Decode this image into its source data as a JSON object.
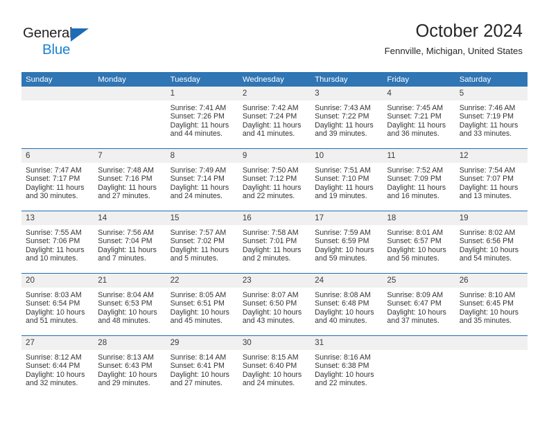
{
  "logo": {
    "line1": "General",
    "line2": "Blue",
    "triangle_color": "#1d6cb5",
    "line2_color": "#1b82d2"
  },
  "header": {
    "title": "October 2024",
    "subtitle": "Fennville, Michigan, United States"
  },
  "colors": {
    "header_row": "#3075b4",
    "day_band": "#f0f0f0",
    "row_divider": "#1d6cb5",
    "text": "#333333"
  },
  "calendar": {
    "weekday_headers": [
      "Sunday",
      "Monday",
      "Tuesday",
      "Wednesday",
      "Thursday",
      "Friday",
      "Saturday"
    ],
    "labels": {
      "sunrise": "Sunrise:",
      "sunset": "Sunset:",
      "daylight": "Daylight:"
    },
    "weeks": [
      [
        {
          "day": "",
          "empty": true,
          "sunrise": "",
          "sunset": "",
          "daylight_line1": "",
          "daylight_line2": ""
        },
        {
          "day": "",
          "empty": true,
          "sunrise": "",
          "sunset": "",
          "daylight_line1": "",
          "daylight_line2": ""
        },
        {
          "day": "1",
          "sunrise": "Sunrise: 7:41 AM",
          "sunset": "Sunset: 7:26 PM",
          "daylight_line1": "Daylight: 11 hours",
          "daylight_line2": "and 44 minutes."
        },
        {
          "day": "2",
          "sunrise": "Sunrise: 7:42 AM",
          "sunset": "Sunset: 7:24 PM",
          "daylight_line1": "Daylight: 11 hours",
          "daylight_line2": "and 41 minutes."
        },
        {
          "day": "3",
          "sunrise": "Sunrise: 7:43 AM",
          "sunset": "Sunset: 7:22 PM",
          "daylight_line1": "Daylight: 11 hours",
          "daylight_line2": "and 39 minutes."
        },
        {
          "day": "4",
          "sunrise": "Sunrise: 7:45 AM",
          "sunset": "Sunset: 7:21 PM",
          "daylight_line1": "Daylight: 11 hours",
          "daylight_line2": "and 36 minutes."
        },
        {
          "day": "5",
          "sunrise": "Sunrise: 7:46 AM",
          "sunset": "Sunset: 7:19 PM",
          "daylight_line1": "Daylight: 11 hours",
          "daylight_line2": "and 33 minutes."
        }
      ],
      [
        {
          "day": "6",
          "sunrise": "Sunrise: 7:47 AM",
          "sunset": "Sunset: 7:17 PM",
          "daylight_line1": "Daylight: 11 hours",
          "daylight_line2": "and 30 minutes."
        },
        {
          "day": "7",
          "sunrise": "Sunrise: 7:48 AM",
          "sunset": "Sunset: 7:16 PM",
          "daylight_line1": "Daylight: 11 hours",
          "daylight_line2": "and 27 minutes."
        },
        {
          "day": "8",
          "sunrise": "Sunrise: 7:49 AM",
          "sunset": "Sunset: 7:14 PM",
          "daylight_line1": "Daylight: 11 hours",
          "daylight_line2": "and 24 minutes."
        },
        {
          "day": "9",
          "sunrise": "Sunrise: 7:50 AM",
          "sunset": "Sunset: 7:12 PM",
          "daylight_line1": "Daylight: 11 hours",
          "daylight_line2": "and 22 minutes."
        },
        {
          "day": "10",
          "sunrise": "Sunrise: 7:51 AM",
          "sunset": "Sunset: 7:10 PM",
          "daylight_line1": "Daylight: 11 hours",
          "daylight_line2": "and 19 minutes."
        },
        {
          "day": "11",
          "sunrise": "Sunrise: 7:52 AM",
          "sunset": "Sunset: 7:09 PM",
          "daylight_line1": "Daylight: 11 hours",
          "daylight_line2": "and 16 minutes."
        },
        {
          "day": "12",
          "sunrise": "Sunrise: 7:54 AM",
          "sunset": "Sunset: 7:07 PM",
          "daylight_line1": "Daylight: 11 hours",
          "daylight_line2": "and 13 minutes."
        }
      ],
      [
        {
          "day": "13",
          "sunrise": "Sunrise: 7:55 AM",
          "sunset": "Sunset: 7:06 PM",
          "daylight_line1": "Daylight: 11 hours",
          "daylight_line2": "and 10 minutes."
        },
        {
          "day": "14",
          "sunrise": "Sunrise: 7:56 AM",
          "sunset": "Sunset: 7:04 PM",
          "daylight_line1": "Daylight: 11 hours",
          "daylight_line2": "and 7 minutes."
        },
        {
          "day": "15",
          "sunrise": "Sunrise: 7:57 AM",
          "sunset": "Sunset: 7:02 PM",
          "daylight_line1": "Daylight: 11 hours",
          "daylight_line2": "and 5 minutes."
        },
        {
          "day": "16",
          "sunrise": "Sunrise: 7:58 AM",
          "sunset": "Sunset: 7:01 PM",
          "daylight_line1": "Daylight: 11 hours",
          "daylight_line2": "and 2 minutes."
        },
        {
          "day": "17",
          "sunrise": "Sunrise: 7:59 AM",
          "sunset": "Sunset: 6:59 PM",
          "daylight_line1": "Daylight: 10 hours",
          "daylight_line2": "and 59 minutes."
        },
        {
          "day": "18",
          "sunrise": "Sunrise: 8:01 AM",
          "sunset": "Sunset: 6:57 PM",
          "daylight_line1": "Daylight: 10 hours",
          "daylight_line2": "and 56 minutes."
        },
        {
          "day": "19",
          "sunrise": "Sunrise: 8:02 AM",
          "sunset": "Sunset: 6:56 PM",
          "daylight_line1": "Daylight: 10 hours",
          "daylight_line2": "and 54 minutes."
        }
      ],
      [
        {
          "day": "20",
          "sunrise": "Sunrise: 8:03 AM",
          "sunset": "Sunset: 6:54 PM",
          "daylight_line1": "Daylight: 10 hours",
          "daylight_line2": "and 51 minutes."
        },
        {
          "day": "21",
          "sunrise": "Sunrise: 8:04 AM",
          "sunset": "Sunset: 6:53 PM",
          "daylight_line1": "Daylight: 10 hours",
          "daylight_line2": "and 48 minutes."
        },
        {
          "day": "22",
          "sunrise": "Sunrise: 8:05 AM",
          "sunset": "Sunset: 6:51 PM",
          "daylight_line1": "Daylight: 10 hours",
          "daylight_line2": "and 45 minutes."
        },
        {
          "day": "23",
          "sunrise": "Sunrise: 8:07 AM",
          "sunset": "Sunset: 6:50 PM",
          "daylight_line1": "Daylight: 10 hours",
          "daylight_line2": "and 43 minutes."
        },
        {
          "day": "24",
          "sunrise": "Sunrise: 8:08 AM",
          "sunset": "Sunset: 6:48 PM",
          "daylight_line1": "Daylight: 10 hours",
          "daylight_line2": "and 40 minutes."
        },
        {
          "day": "25",
          "sunrise": "Sunrise: 8:09 AM",
          "sunset": "Sunset: 6:47 PM",
          "daylight_line1": "Daylight: 10 hours",
          "daylight_line2": "and 37 minutes."
        },
        {
          "day": "26",
          "sunrise": "Sunrise: 8:10 AM",
          "sunset": "Sunset: 6:45 PM",
          "daylight_line1": "Daylight: 10 hours",
          "daylight_line2": "and 35 minutes."
        }
      ],
      [
        {
          "day": "27",
          "sunrise": "Sunrise: 8:12 AM",
          "sunset": "Sunset: 6:44 PM",
          "daylight_line1": "Daylight: 10 hours",
          "daylight_line2": "and 32 minutes."
        },
        {
          "day": "28",
          "sunrise": "Sunrise: 8:13 AM",
          "sunset": "Sunset: 6:43 PM",
          "daylight_line1": "Daylight: 10 hours",
          "daylight_line2": "and 29 minutes."
        },
        {
          "day": "29",
          "sunrise": "Sunrise: 8:14 AM",
          "sunset": "Sunset: 6:41 PM",
          "daylight_line1": "Daylight: 10 hours",
          "daylight_line2": "and 27 minutes."
        },
        {
          "day": "30",
          "sunrise": "Sunrise: 8:15 AM",
          "sunset": "Sunset: 6:40 PM",
          "daylight_line1": "Daylight: 10 hours",
          "daylight_line2": "and 24 minutes."
        },
        {
          "day": "31",
          "sunrise": "Sunrise: 8:16 AM",
          "sunset": "Sunset: 6:38 PM",
          "daylight_line1": "Daylight: 10 hours",
          "daylight_line2": "and 22 minutes."
        },
        {
          "day": "",
          "empty": true,
          "sunrise": "",
          "sunset": "",
          "daylight_line1": "",
          "daylight_line2": ""
        },
        {
          "day": "",
          "empty": true,
          "sunrise": "",
          "sunset": "",
          "daylight_line1": "",
          "daylight_line2": ""
        }
      ]
    ]
  }
}
